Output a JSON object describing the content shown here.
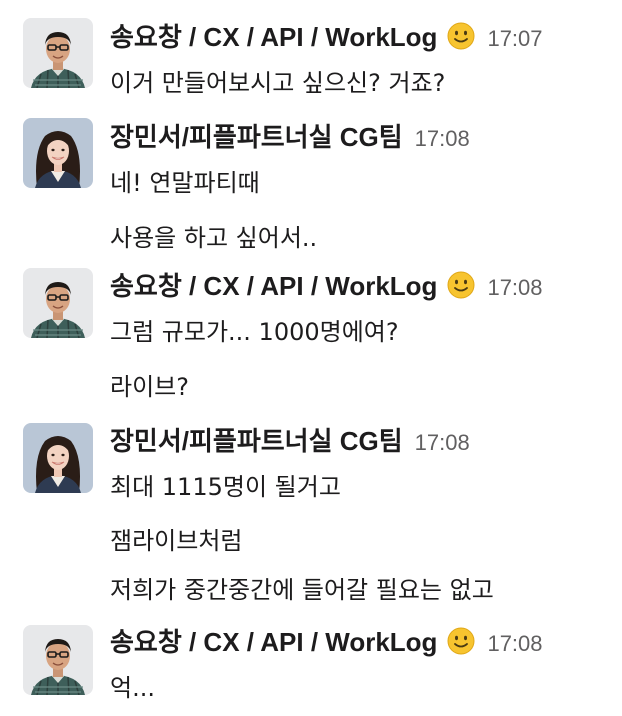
{
  "messages": [
    {
      "sender": "송요창 / CX / API / WorkLog",
      "avatar": "male-profile-photo",
      "status_emoji": "slightly-smiling-face-icon",
      "time": "17:07",
      "lines": [
        "이거 만들어보시고 싶으신? 거죠?"
      ]
    },
    {
      "sender": "장민서/피플파트너실 CG팀",
      "avatar": "female-profile-photo",
      "time": "17:08",
      "lines": [
        "네! 연말파티때",
        "사용을 하고 싶어서.."
      ]
    },
    {
      "sender": "송요창 / CX / API / WorkLog",
      "avatar": "male-profile-photo",
      "status_emoji": "slightly-smiling-face-icon",
      "time": "17:08",
      "lines": [
        "그럼 규모가... 1000명에여?",
        "라이브?"
      ]
    },
    {
      "sender": "장민서/피플파트너실 CG팀",
      "avatar": "female-profile-photo",
      "time": "17:08",
      "lines": [
        "최대 1115명이 될거고",
        "잼라이브처럼",
        "저희가 중간중간에 들어갈 필요는 없고"
      ]
    },
    {
      "sender": "송요창 / CX / API / WorkLog",
      "avatar": "male-profile-photo",
      "status_emoji": "slightly-smiling-face-icon",
      "time": "17:08",
      "lines": [
        "억..."
      ]
    }
  ],
  "colors": {
    "background": "#ffffff",
    "text": "#1d1c1d",
    "timestamp": "#616061",
    "emoji": "#f7c42f"
  }
}
